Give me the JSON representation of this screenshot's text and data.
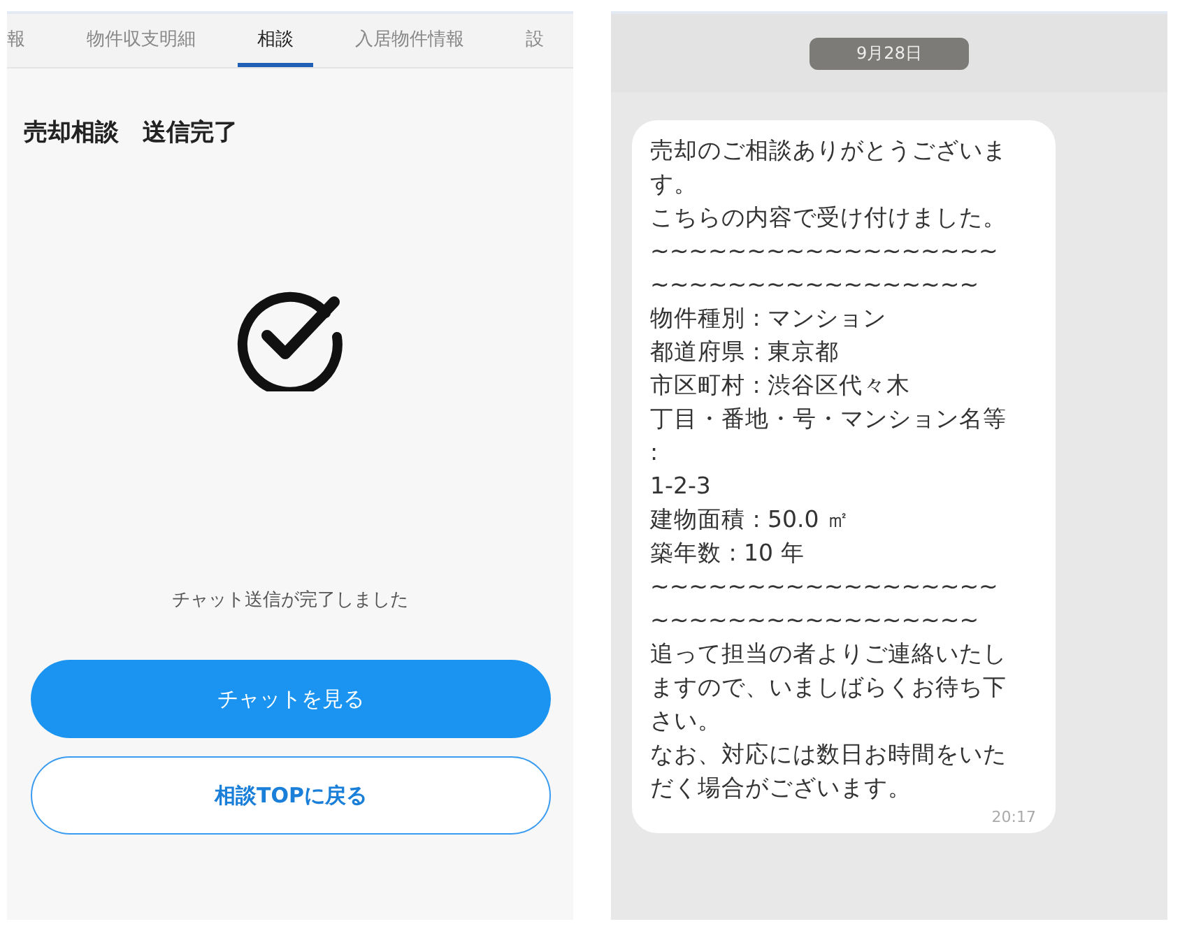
{
  "left_panel": {
    "tabs": [
      {
        "label": "報",
        "selected": false
      },
      {
        "label": "物件収支明細",
        "selected": false
      },
      {
        "label": "相談",
        "selected": true
      },
      {
        "label": "入居物件情報",
        "selected": false
      },
      {
        "label": "設",
        "selected": false
      }
    ],
    "title": "売却相談　送信完了",
    "message": "チャット送信が完了しました",
    "buttons": [
      {
        "label": "チャットを見る",
        "kind": "primary"
      },
      {
        "label": "相談TOPに戻る",
        "kind": "outline"
      }
    ]
  },
  "chat": {
    "date": "9月28日",
    "message": {
      "lines": [
        "売却のご相談ありがとうございます。",
        "こちらの内容で受け付けました。",
        "~~~~~~~~~~~~~~~~~~~~~~~~~~~~~~~~~~~",
        "物件種別 : マンション",
        "都道府県 : 東京都",
        "市区町村 : 渋谷区代々木",
        "丁目・番地・号・マンション名等 :",
        "1-2-3",
        "建物面積 : 50.0 ㎡",
        "築年数 : 10 年",
        "~~~~~~~~~~~~~~~~~~~~~~~~~~~~~~~~~~~",
        "追って担当の者よりご連絡いたしますので、いましばらくお待ち下さい。",
        "なお、対応には数日お時間をいただく場合がございます。"
      ],
      "time": "20:17"
    }
  }
}
